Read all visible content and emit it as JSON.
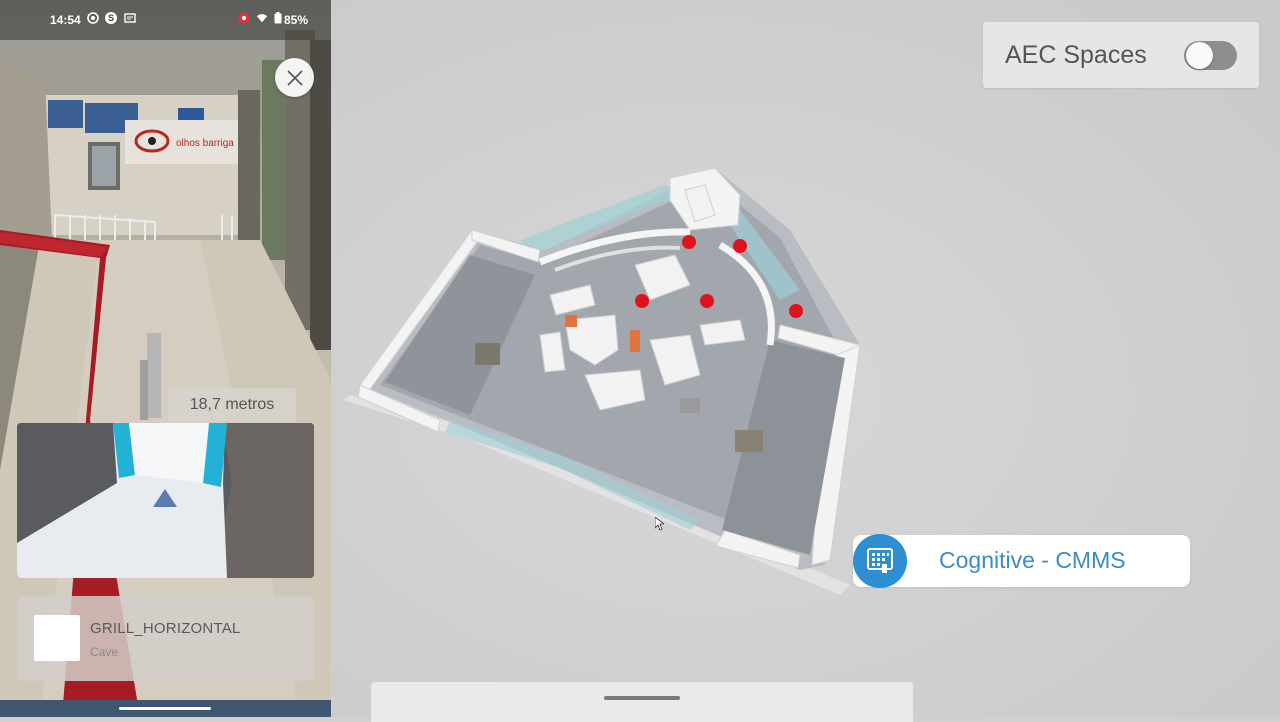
{
  "status_bar": {
    "time": "14:54",
    "battery": "85%",
    "icons": [
      "settings-icon",
      "skype-icon",
      "notification-icon",
      "record-icon",
      "wifi-icon",
      "battery-icon"
    ]
  },
  "ar_view": {
    "sign_text": "olhos barriga",
    "distance": "18,7 metros",
    "close_icon": "close-icon"
  },
  "asset_card": {
    "name": "GRILL_HORIZONTAL",
    "location": "Cave"
  },
  "aec_spaces": {
    "label": "AEC Spaces",
    "toggle_on": false
  },
  "cmms": {
    "label": "Cognitive - CMMS",
    "icon": "building-icon",
    "color": "#2d8ed1"
  },
  "colors": {
    "path_red": "#a51c24",
    "marker_red": "#e0131c",
    "accent_blue": "#2d8ed1"
  }
}
